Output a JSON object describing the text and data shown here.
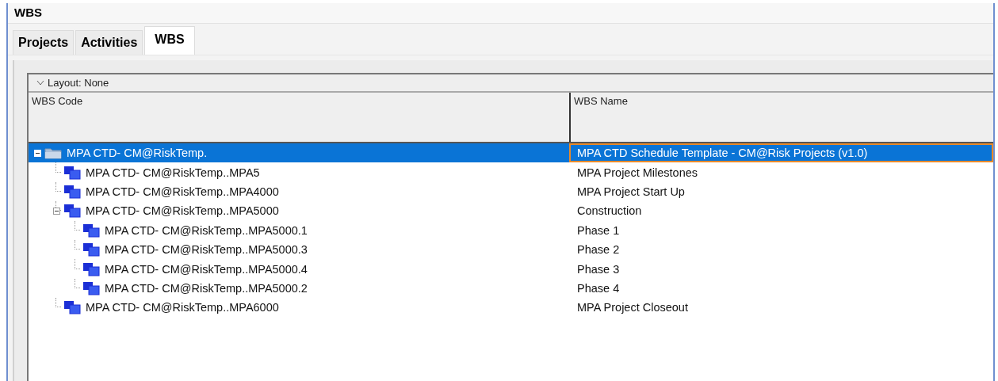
{
  "window": {
    "title": "WBS"
  },
  "tabs": [
    {
      "label": "Projects",
      "selected": false
    },
    {
      "label": "Activities",
      "selected": false
    },
    {
      "label": "WBS",
      "selected": true
    }
  ],
  "layout_bar": {
    "label": "Layout: None"
  },
  "table": {
    "columns": [
      "WBS Code",
      "WBS Name"
    ],
    "rows": [
      {
        "code": "MPA CTD- CM@RiskTemp.",
        "name": "MPA CTD Schedule Template - CM@Risk Projects (v1.0)",
        "selected": true,
        "expanded": true,
        "children": [
          {
            "code": "MPA CTD- CM@RiskTemp..MPA5",
            "name": "MPA Project Milestones",
            "selected": false
          },
          {
            "code": "MPA CTD- CM@RiskTemp..MPA4000",
            "name": "MPA Project Start Up",
            "selected": false
          },
          {
            "code": "MPA CTD- CM@RiskTemp..MPA5000",
            "name": "Construction",
            "selected": false,
            "expanded": true,
            "children": [
              {
                "code": "MPA CTD- CM@RiskTemp..MPA5000.1",
                "name": "Phase 1",
                "selected": false
              },
              {
                "code": "MPA CTD- CM@RiskTemp..MPA5000.3",
                "name": "Phase 2",
                "selected": false
              },
              {
                "code": "MPA CTD- CM@RiskTemp..MPA5000.4",
                "name": "Phase 3",
                "selected": false
              },
              {
                "code": "MPA CTD- CM@RiskTemp..MPA5000.2",
                "name": "Phase 4",
                "selected": false
              }
            ]
          },
          {
            "code": "MPA CTD- CM@RiskTemp..MPA6000",
            "name": "MPA Project Closeout",
            "selected": false
          }
        ]
      }
    ]
  }
}
